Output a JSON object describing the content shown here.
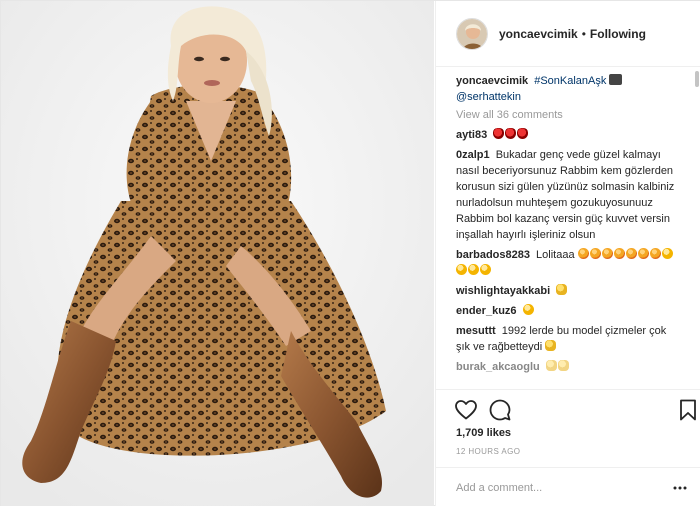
{
  "header": {
    "username": "yoncaevcimik",
    "separator": "•",
    "follow_state": "Following",
    "avatar_icon": "avatar-photo"
  },
  "caption": {
    "username": "yoncaevcimik",
    "hashtag": "#SonKalanAşk",
    "mention": "@serhattekin",
    "emoji_icon": "camera-icon"
  },
  "view_all": "View all 36 comments",
  "comments": [
    {
      "user": "ayti83",
      "text": "",
      "emoji": [
        "rose",
        "rose",
        "rose"
      ]
    },
    {
      "user": "0zalp1",
      "text": "Bukadar genç vede güzel kalmayı nasıl beceriyorsunuz Rabbim kem gözlerden korusun sizi gülen yüzünüz solmasin kalbiniz nurladolsun muhteşem gozukuyosunuuz Rabbim bol kazanç versin güç kuvvet versin inşallah hayırlı işleriniz olsun",
      "emoji": []
    },
    {
      "user": "barbados8283",
      "text": "Lolitaaa",
      "emoji": [
        "heart",
        "heart",
        "heart",
        "heart",
        "heart",
        "heart",
        "heart",
        "sad",
        "sad",
        "sad",
        "sad"
      ]
    },
    {
      "user": "wishlightayakkabi",
      "text": "",
      "emoji": [
        "hand"
      ]
    },
    {
      "user": "ender_kuz6",
      "text": "",
      "emoji": [
        "sad"
      ]
    },
    {
      "user": "mesuttt",
      "text": "1992 lerde bu model çizmeler çok şık ve rağbetteydi",
      "emoji": [
        "hand"
      ]
    },
    {
      "user": "burak_akcaoglu",
      "text": "",
      "emoji": [
        "hand",
        "hand"
      ]
    }
  ],
  "actions": {
    "like_icon": "heart-outline-icon",
    "comment_icon": "comment-bubble-icon",
    "save_icon": "bookmark-icon"
  },
  "likes": "1,709 likes",
  "timestamp": "12 HOURS AGO",
  "add_comment": {
    "placeholder": "Add a comment...",
    "more_icon": "ellipsis-icon"
  },
  "colors": {
    "text": "#262626",
    "muted": "#999999",
    "link": "#003569",
    "border": "#efefef"
  }
}
